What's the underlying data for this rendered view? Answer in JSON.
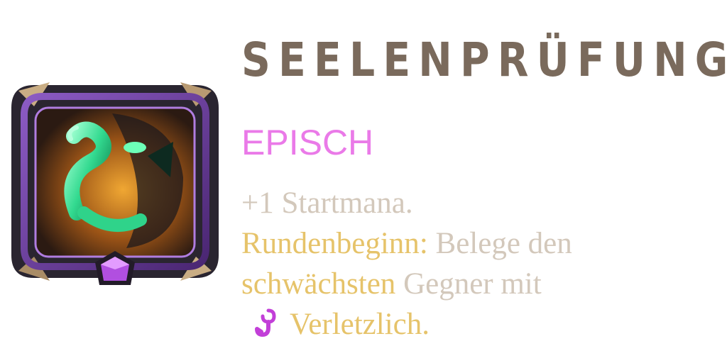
{
  "augment": {
    "title": "SEELENPRÜFUNG",
    "rarity": "EPISCH",
    "icon": "green-tentacle-soul-icon",
    "colors": {
      "title": "#7a6a5c",
      "rarity": "#ea7ae8",
      "text": "#d3c8bb",
      "keyword": "#e6c36a",
      "frame": "#6d3ea0",
      "gem": "#b14fe0"
    },
    "description": {
      "line1": "+1 Startmana.",
      "keyword1": "Rundenbeginn",
      "sep": ":",
      "line2_rest": " Belege den",
      "keyword2": "schwächsten",
      "line3_rest": " Gegner mit",
      "status_icon": "vulnerable-hook-icon",
      "keyword3": "Verletzlich",
      "end": "."
    }
  }
}
